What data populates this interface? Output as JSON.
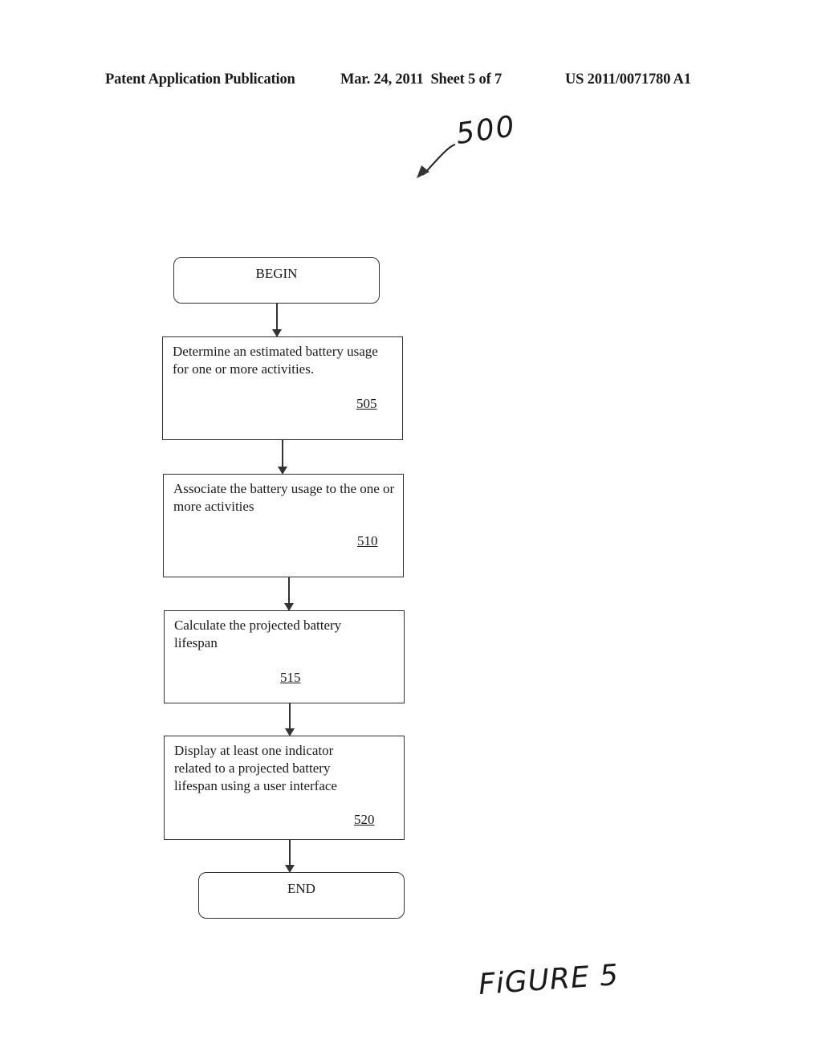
{
  "header": {
    "publication_label": "Patent Application Publication",
    "date_sheet": "Mar. 24, 2011  Sheet 5 of 7",
    "publication_number": "US 2011/0071780 A1"
  },
  "figure": {
    "reference_numeral": "500",
    "caption": "FiGURE 5"
  },
  "flowchart": {
    "begin_label": "BEGIN",
    "end_label": "END",
    "steps": [
      {
        "text": "Determine an estimated battery usage for one or more activities.",
        "ref": "505"
      },
      {
        "text": "Associate the battery usage to the one or more activities",
        "ref": "510"
      },
      {
        "text": "Calculate the projected battery lifespan",
        "ref": "515"
      },
      {
        "text": "Display at least one indicator related to a projected battery lifespan using a user interface",
        "ref": "520"
      }
    ]
  }
}
